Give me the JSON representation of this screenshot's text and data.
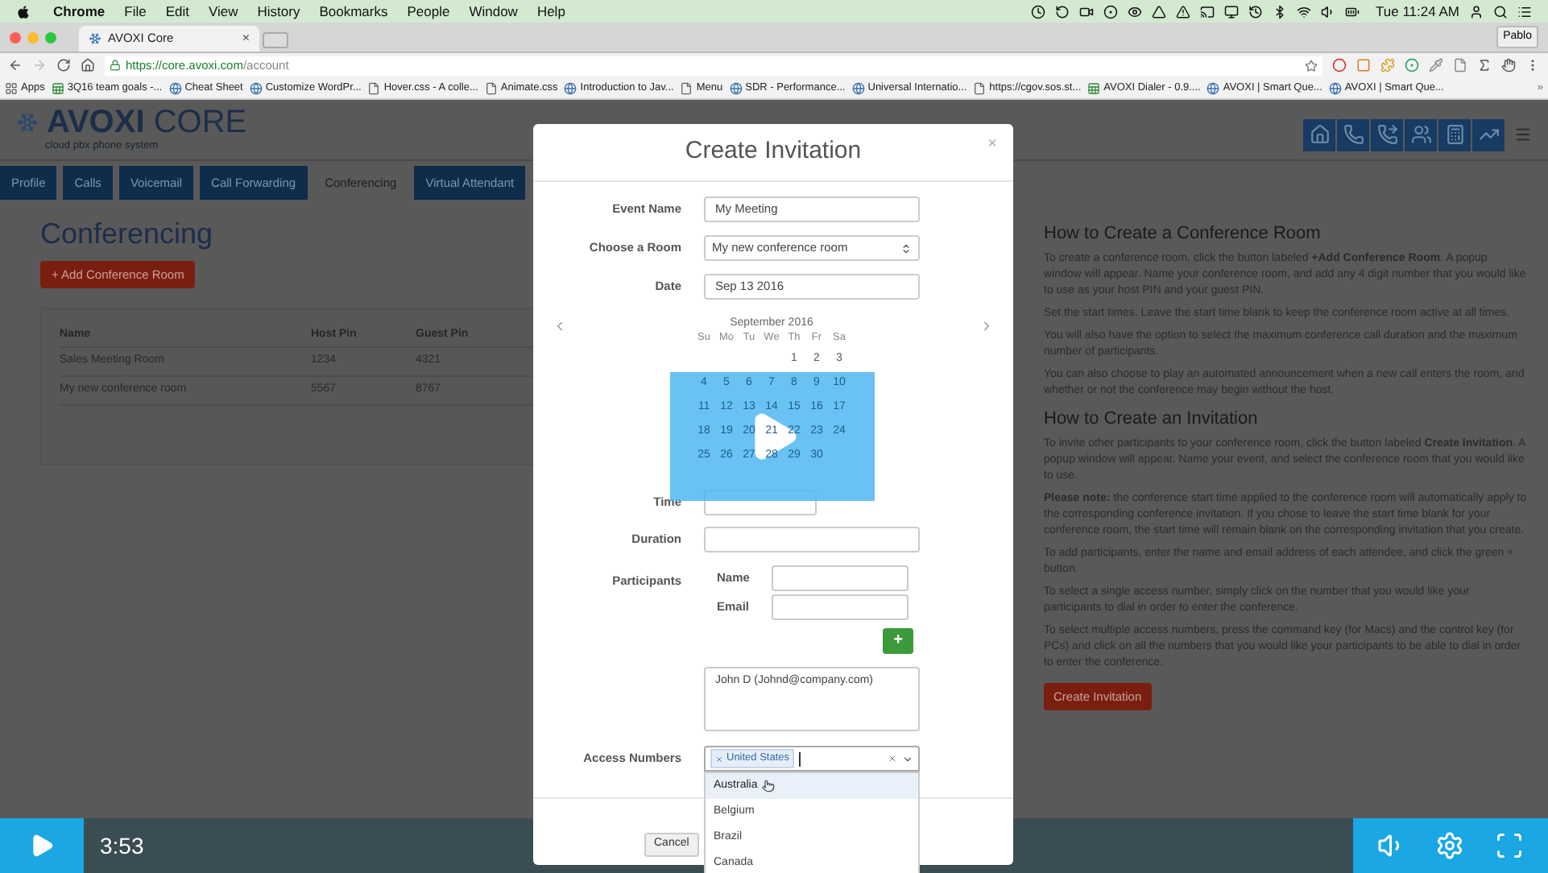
{
  "menubar": {
    "app": "Chrome",
    "menus": [
      "File",
      "Edit",
      "View",
      "History",
      "Bookmarks",
      "People",
      "Window",
      "Help"
    ],
    "clock": "Tue 11:24 AM"
  },
  "browser": {
    "tab_title": "AVOXI Core",
    "tab_close": "×",
    "profile": "Pablo",
    "url_host": "https://core.avoxi.com",
    "url_path": "/account",
    "bookmarks": [
      {
        "kind": "apps",
        "label": "Apps"
      },
      {
        "kind": "sheet",
        "label": "3Q16 team goals -..."
      },
      {
        "kind": "site",
        "label": "Cheat Sheet"
      },
      {
        "kind": "site",
        "label": "Customize WordPr..."
      },
      {
        "kind": "page",
        "label": "Hover.css - A colle..."
      },
      {
        "kind": "page",
        "label": "Animate.css"
      },
      {
        "kind": "site",
        "label": "Introduction to Jav..."
      },
      {
        "kind": "page",
        "label": "Menu"
      },
      {
        "kind": "site",
        "label": "SDR - Performance..."
      },
      {
        "kind": "site",
        "label": "Universal Internatio..."
      },
      {
        "kind": "page",
        "label": "https://cgov.sos.st..."
      },
      {
        "kind": "sheet",
        "label": "AVOXI Dialer - 0.9...."
      },
      {
        "kind": "site",
        "label": "AVOXI | Smart Que..."
      },
      {
        "kind": "site",
        "label": "AVOXI | Smart Que..."
      }
    ],
    "bookmarks_more": "»"
  },
  "app": {
    "logo_name": "AVOXI",
    "logo_suffix": "CORE",
    "tagline": "cloud pbx phone system",
    "tabs": [
      {
        "label": "Profile",
        "selected": false
      },
      {
        "label": "Calls",
        "selected": false
      },
      {
        "label": "Voicemail",
        "selected": false
      },
      {
        "label": "Call Forwarding",
        "selected": false
      },
      {
        "label": "Conferencing",
        "selected": true
      },
      {
        "label": "Virtual Attendant",
        "selected": false
      }
    ],
    "heading": "Conferencing",
    "add_button": "+ Add Conference Room",
    "table": {
      "columns": [
        "Name",
        "Host Pin",
        "Guest Pin"
      ],
      "rows": [
        [
          "Sales Meeting Room",
          "1234",
          "4321"
        ],
        [
          "My new conference room",
          "5567",
          "8767"
        ]
      ]
    },
    "help": [
      {
        "kind": "heading",
        "text": "How to Create a Conference Room"
      },
      {
        "kind": "paragraph",
        "text": "To create a conference room, click the button labeled **+Add Conference Room**. A popup window will appear. Name your conference room, and add any 4 digit number that you would like to use as your host PIN and your guest PIN."
      },
      {
        "kind": "paragraph",
        "text": "Set the start times. Leave the start time blank to keep the conference room active at all times."
      },
      {
        "kind": "paragraph",
        "text": "You will also have the option to select the maximum conference call duration and the maximum number of participants."
      },
      {
        "kind": "paragraph",
        "text": "You can also choose to play an automated announcement when a new call enters the room, and whether or not the conference may begin without the host."
      },
      {
        "kind": "heading",
        "text": "How to Create an Invitation"
      },
      {
        "kind": "paragraph",
        "text": "To invite other participants to your conference room, click the button labeled **Create Invitation**. A popup window will appear. Name your event, and select the conference room that you would like to use."
      },
      {
        "kind": "paragraph",
        "text": "**Please note:** the conference start time applied to the conference room will automatically apply to the corresponding conference invitation. If you chose to leave the start time blank for your conference room, the start time will remain blank on the corresponding invitation that you create."
      },
      {
        "kind": "paragraph",
        "text": "To add participants, enter the name and email address of each attendee, and click the green + button."
      },
      {
        "kind": "paragraph",
        "text": "To select a single access number, simply click on the number that you would like your participants to dial in order to enter the conference."
      },
      {
        "kind": "paragraph",
        "text": "To select multiple access numbers, press the command key (for Macs) and the control key (for PCs) and click on all the numbers that you would like your participants to be able to dial in order to enter the conference."
      }
    ],
    "create_button": "Create Invitation"
  },
  "modal": {
    "title": "Create Invitation",
    "close": "×",
    "event_name": {
      "label": "Event Name",
      "value": "My Meeting"
    },
    "room": {
      "label": "Choose a Room",
      "value": "My new conference room"
    },
    "date": {
      "label": "Date",
      "value": "Sep 13 2016"
    },
    "calendar": {
      "month": "September 2016",
      "weekdays": [
        "Su",
        "Mo",
        "Tu",
        "We",
        "Th",
        "Fr",
        "Sa"
      ],
      "weeks": [
        [
          "1",
          "2",
          "3"
        ],
        [
          "4",
          "5",
          "6",
          "7",
          "8",
          "9",
          "10"
        ],
        [
          "11",
          "12",
          "13",
          "14",
          "15",
          "16",
          "17"
        ],
        [
          "18",
          "19",
          "20",
          "21",
          "22",
          "23",
          "24"
        ],
        [
          "25",
          "26",
          "27",
          "28",
          "29",
          "30"
        ]
      ]
    },
    "time": {
      "label": "Time"
    },
    "duration": {
      "label": "Duration"
    },
    "participants": {
      "label": "Participants",
      "name_label": "Name",
      "email_label": "Email",
      "add": "+",
      "list": [
        "John D (Johnd@company.com)"
      ]
    },
    "access": {
      "label": "Access Numbers",
      "tags": [
        "United States"
      ],
      "options": [
        {
          "label": "Australia",
          "highlighted": true
        },
        {
          "label": "Belgium",
          "highlighted": false
        },
        {
          "label": "Brazil",
          "highlighted": false
        },
        {
          "label": "Canada",
          "highlighted": false
        }
      ]
    },
    "cancel": "Cancel"
  },
  "video": {
    "time": "3:53"
  }
}
